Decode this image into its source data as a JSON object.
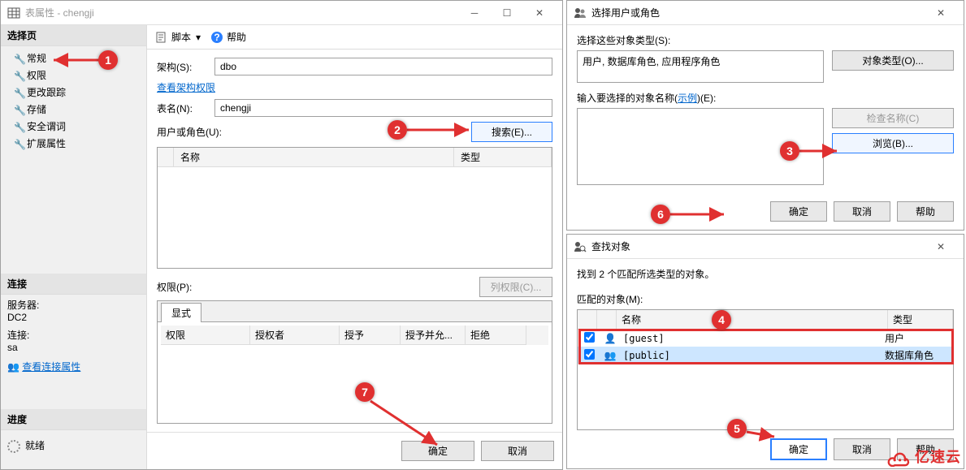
{
  "win1": {
    "title": "表属性 - chengji",
    "toolbar": {
      "script": "脚本",
      "help": "帮助"
    },
    "sidebar": {
      "select_page": "选择页",
      "items": [
        "常规",
        "权限",
        "更改跟踪",
        "存储",
        "安全谓词",
        "扩展属性"
      ],
      "conn_header": "连接",
      "server_label": "服务器:",
      "server_value": "DC2",
      "conn_label": "连接:",
      "conn_value": "sa",
      "view_conn": "查看连接属性",
      "progress_header": "进度",
      "ready": "就绪"
    },
    "form": {
      "schema_label": "架构(S):",
      "schema_value": "dbo",
      "view_perms": "查看架构权限",
      "table_label": "表名(N):",
      "table_value": "chengji",
      "users_label": "用户或角色(U):",
      "search_btn": "搜索(E)...",
      "col_name": "名称",
      "col_type": "类型",
      "perm_label": "权限(P):",
      "col_perm_btn": "列权限(C)...",
      "tab_explicit": "显式",
      "grid": {
        "perm": "权限",
        "grantor": "授权者",
        "grant": "授予",
        "grant_with": "授予并允...",
        "deny": "拒绝"
      }
    },
    "footer": {
      "ok": "确定",
      "cancel": "取消"
    }
  },
  "win2": {
    "title": "选择用户或角色",
    "select_types_label": "选择这些对象类型(S):",
    "types_value": "用户, 数据库角色, 应用程序角色",
    "object_types_btn": "对象类型(O)...",
    "enter_names_label": "输入要选择的对象名称",
    "example_link": "示例",
    "enter_names_suffix": "(E):",
    "check_names_btn": "检查名称(C)",
    "browse_btn": "浏览(B)...",
    "ok": "确定",
    "cancel": "取消",
    "help": "帮助"
  },
  "win3": {
    "title": "查找对象",
    "found_text": "找到 2 个匹配所选类型的对象。",
    "matched_label": "匹配的对象(M):",
    "col_name": "名称",
    "col_type": "类型",
    "rows": [
      {
        "name": "[guest]",
        "type": "用户"
      },
      {
        "name": "[public]",
        "type": "数据库角色"
      }
    ],
    "ok": "确定",
    "cancel": "取消",
    "help": "帮助"
  },
  "markers": [
    "1",
    "2",
    "3",
    "4",
    "5",
    "6",
    "7"
  ],
  "watermark": "亿速云"
}
